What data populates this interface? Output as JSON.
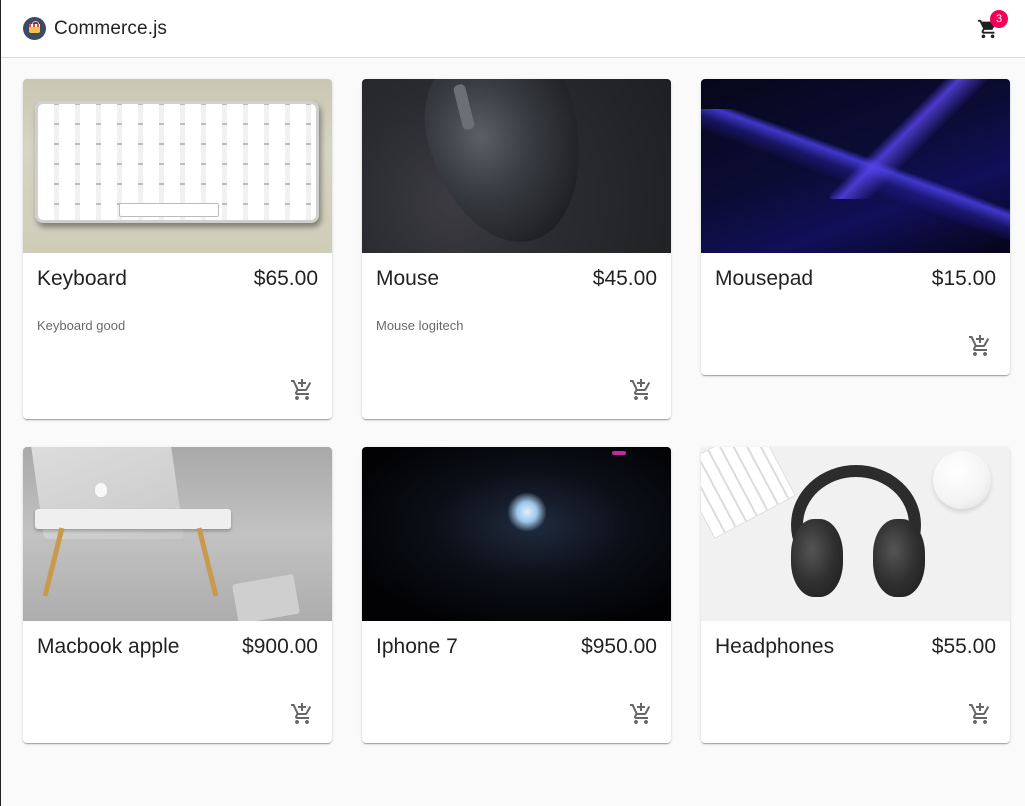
{
  "app": {
    "title": "Commerce.js",
    "logo_icon": "shopping-bag-logo-icon",
    "cart_count": "3",
    "badge_color": "#f50057"
  },
  "products": [
    {
      "name": "Keyboard",
      "price": "$65.00",
      "description": "Keyboard good",
      "image_icon": "keyboard-photo"
    },
    {
      "name": "Mouse",
      "price": "$45.00",
      "description": "Mouse logitech",
      "image_icon": "mouse-photo"
    },
    {
      "name": "Mousepad",
      "price": "$15.00",
      "description": "",
      "image_icon": "mousepad-photo"
    },
    {
      "name": "Macbook apple",
      "price": "$900.00",
      "description": "",
      "image_icon": "macbook-photo"
    },
    {
      "name": "Iphone 7",
      "price": "$950.00",
      "description": "",
      "image_icon": "iphone-photo"
    },
    {
      "name": "Headphones",
      "price": "$55.00",
      "description": "",
      "image_icon": "headphones-photo"
    }
  ]
}
